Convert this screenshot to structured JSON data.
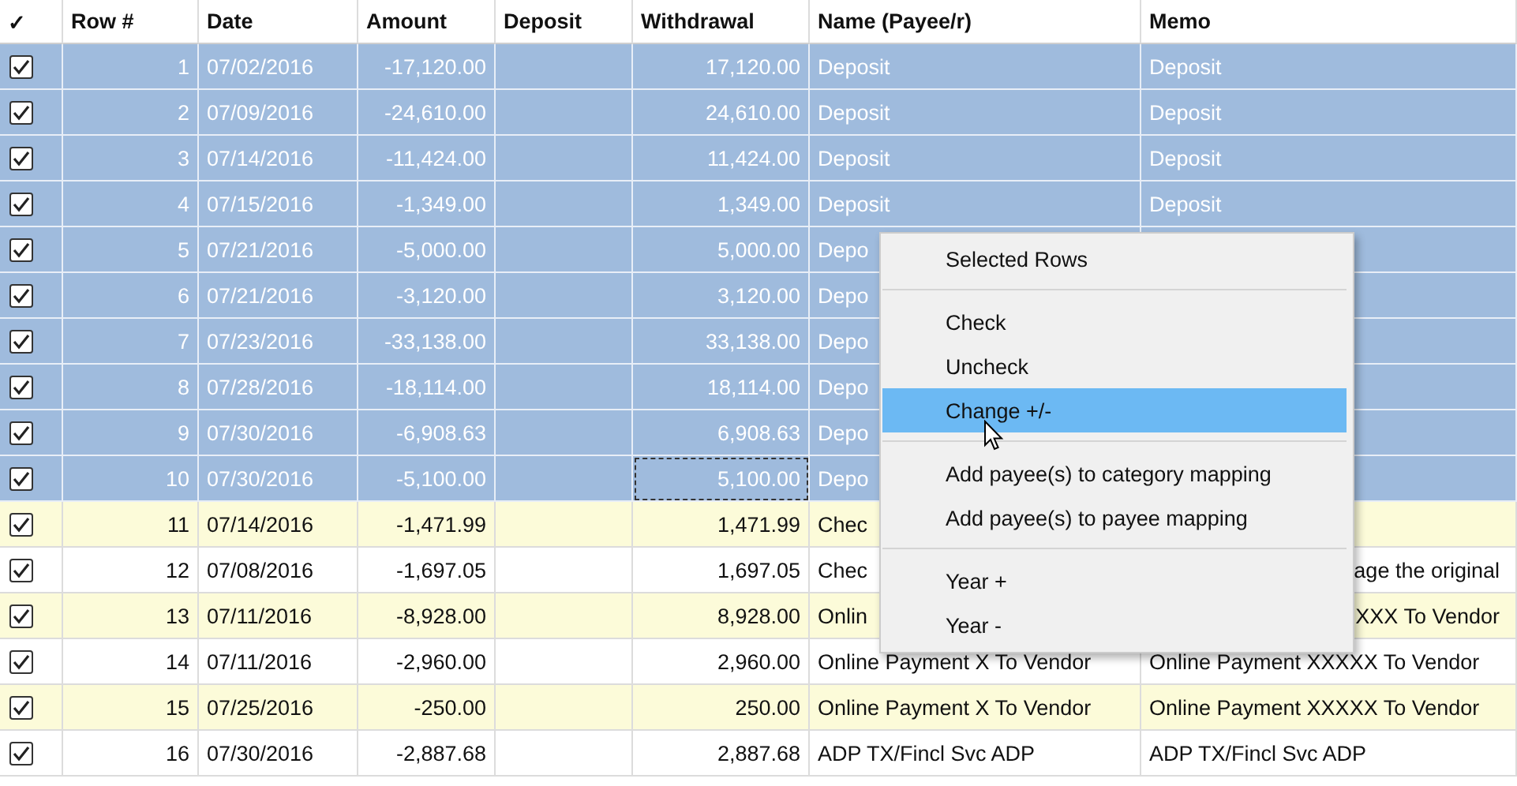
{
  "columns": [
    {
      "label": "✓",
      "kind": "check"
    },
    {
      "label": "Row #",
      "kind": "num"
    },
    {
      "label": "Date",
      "kind": "text"
    },
    {
      "label": "Amount",
      "kind": "num"
    },
    {
      "label": "Deposit",
      "kind": "num"
    },
    {
      "label": "Withdrawal",
      "kind": "num"
    },
    {
      "label": "Name (Payee/r)",
      "kind": "text"
    },
    {
      "label": "Memo",
      "kind": "text"
    }
  ],
  "rows": [
    {
      "checked": true,
      "selected": true,
      "focused": false,
      "cells": [
        "1",
        "07/02/2016",
        "-17,120.00",
        "",
        "17,120.00",
        "Deposit",
        "Deposit"
      ]
    },
    {
      "checked": true,
      "selected": true,
      "focused": false,
      "cells": [
        "2",
        "07/09/2016",
        "-24,610.00",
        "",
        "24,610.00",
        "Deposit",
        "Deposit"
      ]
    },
    {
      "checked": true,
      "selected": true,
      "focused": false,
      "cells": [
        "3",
        "07/14/2016",
        "-11,424.00",
        "",
        "11,424.00",
        "Deposit",
        "Deposit"
      ]
    },
    {
      "checked": true,
      "selected": true,
      "focused": false,
      "cells": [
        "4",
        "07/15/2016",
        "-1,349.00",
        "",
        "1,349.00",
        "Deposit",
        "Deposit"
      ]
    },
    {
      "checked": true,
      "selected": true,
      "focused": false,
      "cells": [
        "5",
        "07/21/2016",
        "-5,000.00",
        "",
        "5,000.00",
        "Depo",
        ""
      ]
    },
    {
      "checked": true,
      "selected": true,
      "focused": false,
      "cells": [
        "6",
        "07/21/2016",
        "-3,120.00",
        "",
        "3,120.00",
        "Depo",
        ""
      ]
    },
    {
      "checked": true,
      "selected": true,
      "focused": false,
      "cells": [
        "7",
        "07/23/2016",
        "-33,138.00",
        "",
        "33,138.00",
        "Depo",
        ""
      ]
    },
    {
      "checked": true,
      "selected": true,
      "focused": false,
      "cells": [
        "8",
        "07/28/2016",
        "-18,114.00",
        "",
        "18,114.00",
        "Depo",
        ""
      ]
    },
    {
      "checked": true,
      "selected": true,
      "focused": false,
      "cells": [
        "9",
        "07/30/2016",
        "-6,908.63",
        "",
        "6,908.63",
        "Depo",
        ""
      ]
    },
    {
      "checked": true,
      "selected": true,
      "focused": true,
      "cells": [
        "10",
        "07/30/2016",
        "-5,100.00",
        "",
        "5,100.00",
        "Depo",
        ""
      ]
    },
    {
      "checked": true,
      "selected": false,
      "focused": false,
      "cells": [
        "11",
        "07/14/2016",
        "-1,471.99",
        "",
        "1,471.99",
        "Chec",
        ""
      ]
    },
    {
      "checked": true,
      "selected": false,
      "focused": false,
      "memo_covered": true,
      "cells": [
        "12",
        "07/08/2016",
        "-1,697.05",
        "",
        "1,697.05",
        "Chec",
        "age the original"
      ]
    },
    {
      "checked": true,
      "selected": false,
      "focused": false,
      "memo_covered": true,
      "cells": [
        "13",
        "07/11/2016",
        "-8,928.00",
        "",
        "8,928.00",
        "Onlin",
        "XXX To Vendor"
      ]
    },
    {
      "checked": true,
      "selected": false,
      "focused": false,
      "cells": [
        "14",
        "07/11/2016",
        "-2,960.00",
        "",
        "2,960.00",
        "Online Payment X To Vendor",
        "Online Payment XXXXX To Vendor"
      ]
    },
    {
      "checked": true,
      "selected": false,
      "focused": false,
      "cells": [
        "15",
        "07/25/2016",
        "-250.00",
        "",
        "250.00",
        "Online Payment X To Vendor",
        "Online Payment XXXXX To Vendor"
      ]
    },
    {
      "checked": true,
      "selected": false,
      "focused": false,
      "cells": [
        "16",
        "07/30/2016",
        "-2,887.68",
        "",
        "2,887.68",
        "ADP TX/Fincl Svc ADP",
        "ADP TX/Fincl Svc ADP"
      ]
    }
  ],
  "context_menu": {
    "items": [
      {
        "kind": "title",
        "label": "Selected Rows",
        "selected": false
      },
      {
        "kind": "separator"
      },
      {
        "kind": "item",
        "label": "Check",
        "selected": false
      },
      {
        "kind": "item",
        "label": "Uncheck",
        "selected": false
      },
      {
        "kind": "item",
        "label": "Change +/-",
        "selected": true
      },
      {
        "kind": "separator"
      },
      {
        "kind": "item",
        "label": "Add payee(s) to category mapping",
        "selected": false
      },
      {
        "kind": "item",
        "label": "Add payee(s) to payee mapping",
        "selected": false
      },
      {
        "kind": "separator"
      },
      {
        "kind": "item",
        "label": "Year +",
        "selected": false
      },
      {
        "kind": "item",
        "label": "Year -",
        "selected": false
      }
    ]
  }
}
